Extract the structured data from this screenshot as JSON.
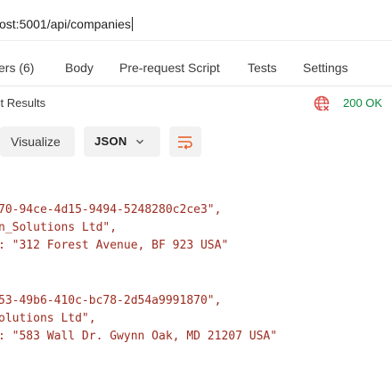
{
  "request": {
    "url": "ost:5001/api/companies"
  },
  "request_tabs": [
    {
      "label": "ers",
      "count": "(6)"
    },
    {
      "label": "Body"
    },
    {
      "label": "Pre-request Script"
    },
    {
      "label": "Tests"
    },
    {
      "label": "Settings"
    }
  ],
  "response": {
    "tab_label": "st Results",
    "status": "200 OK",
    "status_color": "#0a8a3f",
    "globe_icon": "globe-icon",
    "toolbar": {
      "visualize_label": "Visualize",
      "format_label": "JSON",
      "wrap_icon": "wrap-lines-icon"
    },
    "body_lines": [
      {
        "text": "70-94ce-4d15-9494-5248280c2ce3\",",
        "kind": "string"
      },
      {
        "text": "n_Solutions Ltd\",",
        "kind": "string"
      },
      {
        "text": ": \"312 Forest Avenue, BF 923 USA\"",
        "kind": "string"
      },
      {
        "text": "53-49b6-410c-bc78-2d54a9991870\",",
        "kind": "string"
      },
      {
        "text": "olutions Ltd\",",
        "kind": "string"
      },
      {
        "text": ": \"583 Wall Dr. Gwynn Oak, MD 21207 USA\"",
        "kind": "string"
      }
    ]
  }
}
